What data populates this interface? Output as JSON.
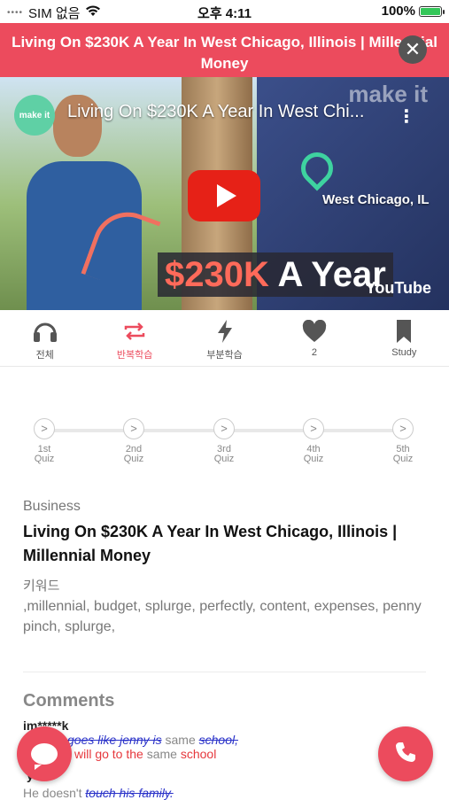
{
  "status_bar": {
    "carrier": "SIM 없음",
    "time": "오후 4:11",
    "battery": "100%"
  },
  "banner": {
    "title": "Living On $230K A Year In West Chicago, Illinois | Millennial Money",
    "close_glyph": "✕"
  },
  "video": {
    "channel_label": "make it",
    "title": "Living On $230K A Year In West Chi...",
    "location": "West Chicago, IL",
    "overlay_amount": "$230K",
    "overlay_text": "A Year",
    "watermark": "make it",
    "youtube_label": "YouTube"
  },
  "tabs": [
    {
      "label": "전체",
      "icon": "headphones-icon"
    },
    {
      "label": "반복학습",
      "icon": "repeat-icon",
      "active": true
    },
    {
      "label": "부분학습",
      "icon": "lightning-icon"
    },
    {
      "label": "2",
      "icon": "heart-icon"
    },
    {
      "label": "Study",
      "icon": "bookmark-icon"
    }
  ],
  "quiz_steps": [
    {
      "line1": "1st",
      "line2": "Quiz"
    },
    {
      "line1": "2nd",
      "line2": "Quiz"
    },
    {
      "line1": "3rd",
      "line2": "Quiz"
    },
    {
      "line1": "4th",
      "line2": "Quiz"
    },
    {
      "line1": "5th",
      "line2": "Quiz"
    }
  ],
  "article": {
    "category": "Business",
    "title": "Living On $230K A Year In West Chicago, Illinois | Millennial Money",
    "keywords_label": "키워드",
    "keywords": ",millennial, budget, splurge, perfectly, content, expenses, penny pinch, splurge,"
  },
  "comments": {
    "heading": "Comments",
    "items": [
      {
        "user": "im*****k",
        "strike1": "goes like jenny is",
        "same1": "same",
        "strike2": "school,",
        "red1": "will go to the",
        "same2": "same",
        "red2": "school"
      },
      {
        "user": "yi*****",
        "plain": "He doesn't",
        "strike": "touch his family."
      }
    ]
  },
  "colors": {
    "accent": "#ec4b5d",
    "strike": "#2b33c9",
    "correction": "#e6373c"
  }
}
